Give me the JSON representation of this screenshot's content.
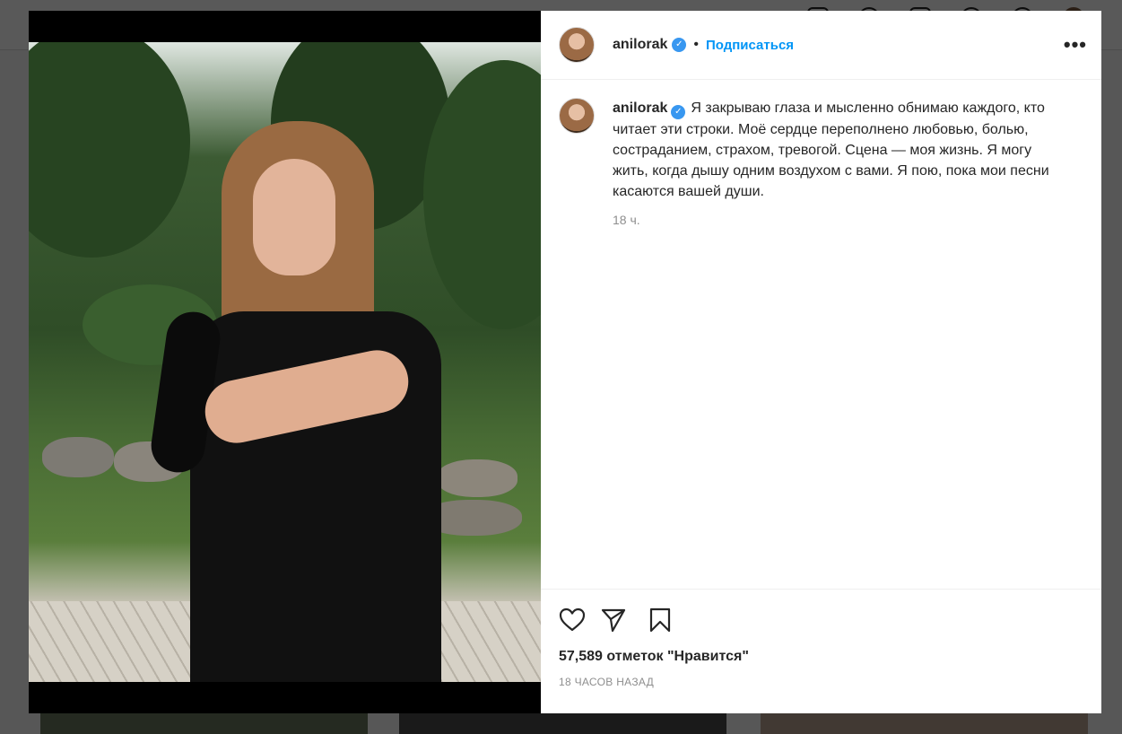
{
  "post": {
    "username": "anilorak",
    "verified_mark": "✓",
    "follow_label": "Подписаться",
    "more_label": "•••",
    "caption": {
      "username": "anilorak",
      "text": "Я закрываю глаза и мысленно обнимаю каждого, кто читает эти строки. Моё сердце переполнено любовью, болью, состраданием, страхом, тревогой. Сцена — моя жизнь. Я могу жить, когда дышу одним воздухом с вами. Я пою, пока мои песни касаются вашей души.",
      "time_ago": "18 ч."
    },
    "likes_text": "57,589 отметок \"Нравится\"",
    "posted_ago": "18 ЧАСОВ НАЗАД"
  },
  "icons": {
    "like": "heart-icon",
    "share": "paper-plane-icon",
    "save": "bookmark-icon",
    "verified": "verified-badge-icon"
  },
  "colors": {
    "follow": "#0095f6",
    "verified": "#3897f0",
    "overlay": "rgba(0,0,0,0.65)",
    "muted": "#8e8e8e"
  }
}
